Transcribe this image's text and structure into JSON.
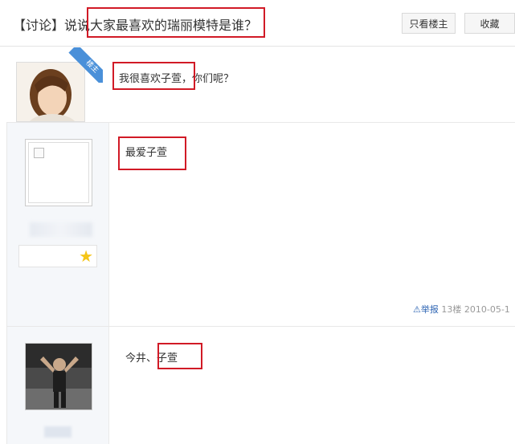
{
  "header": {
    "title": "【讨论】说说大家最喜欢的瑞丽模特是谁？",
    "only_owner_label": "只看楼主",
    "favorite_label": "收藏"
  },
  "posts": [
    {
      "badge": "楼主",
      "content": "我很喜欢子萱，你们呢？"
    },
    {
      "content": "最爱子萱",
      "report_label": "举报",
      "floor": "13楼",
      "date": "2010-05-1"
    },
    {
      "content": "今井、子萱"
    }
  ],
  "colors": {
    "highlight": "#d11a26",
    "ribbon": "#4a90d9",
    "link": "#2d64b3",
    "star": "#f5c518"
  },
  "icons": [
    "star-icon",
    "warning-icon"
  ]
}
